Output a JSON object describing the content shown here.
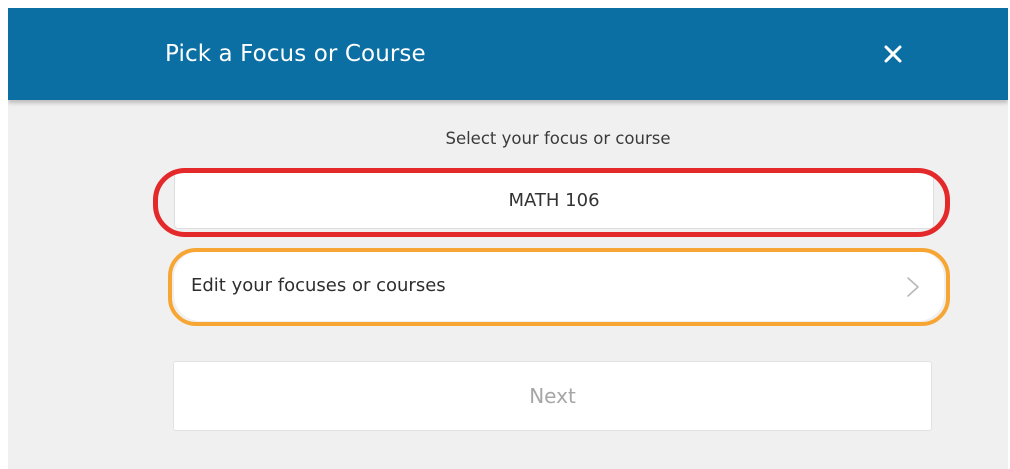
{
  "header": {
    "title": "Pick a Focus or Course",
    "close_icon": "close-icon"
  },
  "main": {
    "subtitle": "Select your focus or course",
    "selected_course": "MATH 106",
    "edit_label": "Edit your focuses or courses",
    "chevron_icon": "chevron-right-icon",
    "next_label": "Next"
  },
  "colors": {
    "header_bg": "#0b6fa3",
    "highlight_red": "#e4292a",
    "highlight_orange": "#f7a634",
    "disabled_text": "#a6a6a6"
  }
}
